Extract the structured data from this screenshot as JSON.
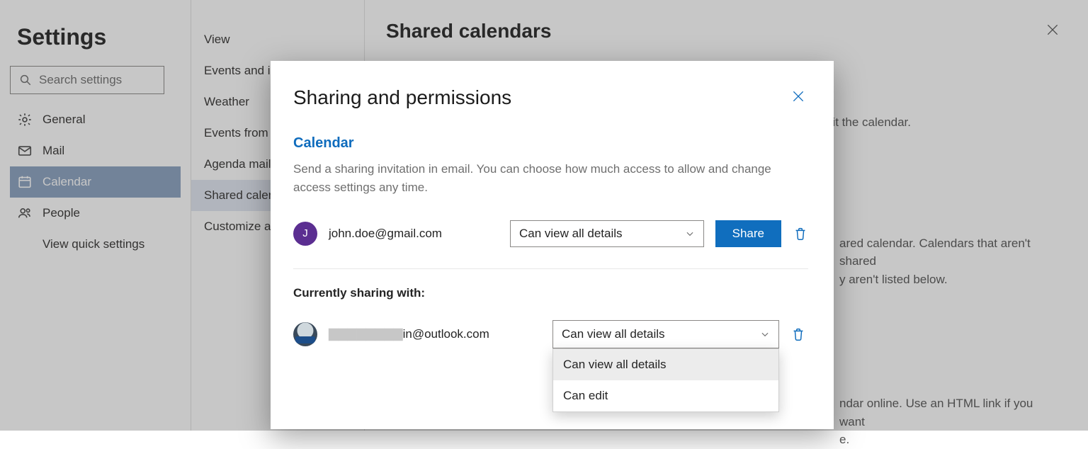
{
  "settings": {
    "title": "Settings",
    "search_placeholder": "Search settings",
    "nav": {
      "general": "General",
      "mail": "Mail",
      "calendar": "Calendar",
      "people": "People",
      "quick": "View quick settings"
    },
    "calendar_menu": {
      "view": "View",
      "events_inv": "Events and invitations",
      "weather": "Weather",
      "events_from": "Events from email",
      "agenda": "Agenda mail",
      "shared": "Shared calendars",
      "customize": "Customize actions"
    }
  },
  "main": {
    "title": "Shared calendars",
    "p1_tail": "dit the calendar.",
    "p2_a": "ared calendar. Calendars that aren't shared",
    "p2_b": "y aren't listed below.",
    "p3_a": "ndar online. Use an HTML link if you want",
    "p3_b": "e."
  },
  "modal": {
    "title": "Sharing and permissions",
    "calendar_link": "Calendar",
    "description": "Send a sharing invitation in email. You can choose how much access to allow and change access settings any time.",
    "invite": {
      "avatar_initial": "J",
      "email": "john.doe@gmail.com",
      "permission": "Can view all details",
      "share_label": "Share"
    },
    "currently_label": "Currently sharing with:",
    "sharee": {
      "email_suffix": "in@outlook.com",
      "permission": "Can view all details"
    },
    "options": {
      "view_all": "Can view all details",
      "edit": "Can edit"
    }
  }
}
